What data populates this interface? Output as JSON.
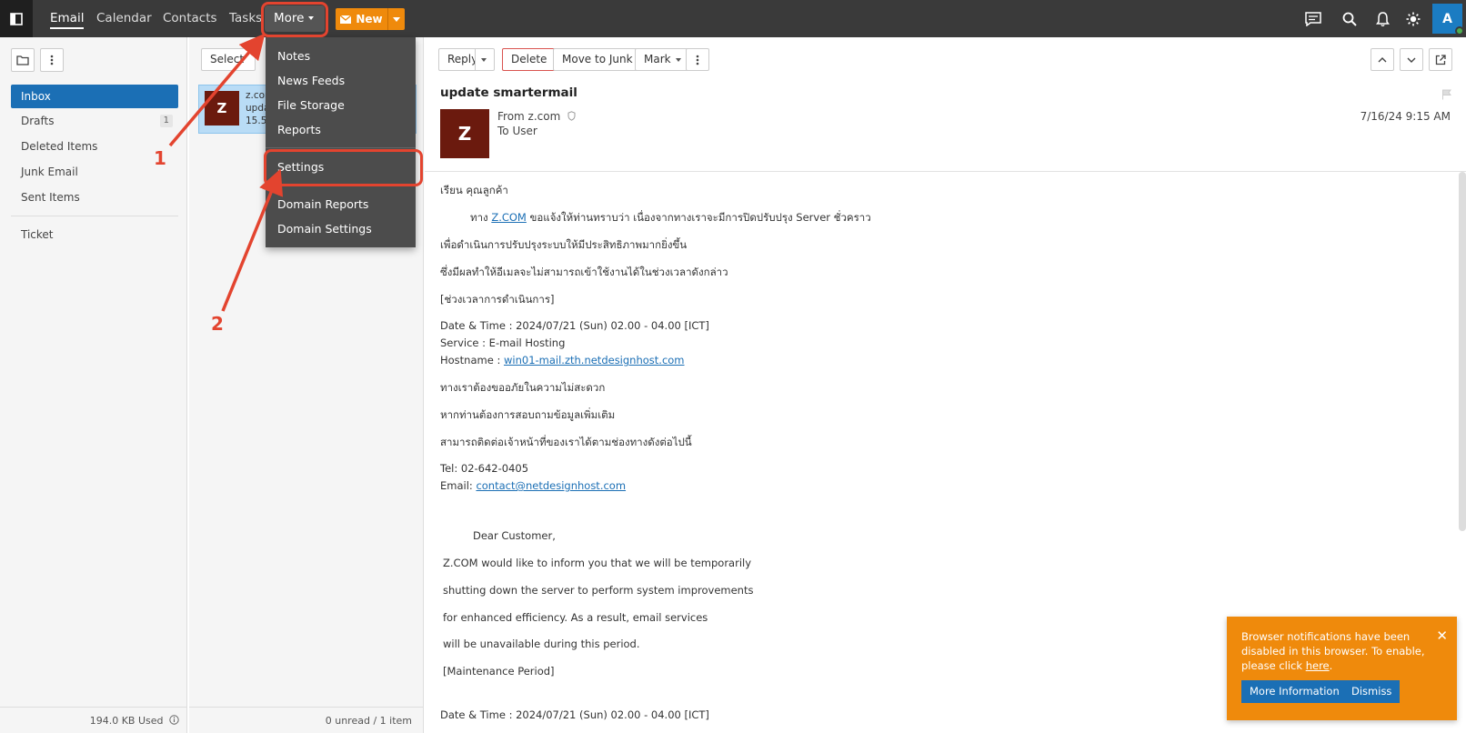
{
  "nav": {
    "tabs": [
      "Email",
      "Calendar",
      "Contacts",
      "Tasks"
    ],
    "more_label": "More",
    "new_label": "New"
  },
  "sidebar": {
    "folders": [
      {
        "label": "Inbox"
      },
      {
        "label": "Drafts",
        "count": "1"
      },
      {
        "label": "Deleted Items"
      },
      {
        "label": "Junk Email"
      },
      {
        "label": "Sent Items"
      }
    ],
    "ticket": "Ticket",
    "storage_used": "194.0 KB Used"
  },
  "list": {
    "select_label": "Select",
    "item": {
      "avatar": "Z",
      "from": "z.com",
      "subject": "upda",
      "size": "15.5 K"
    },
    "footer": "0 unread / 1 item"
  },
  "menu": {
    "items_top": [
      "Notes",
      "News Feeds",
      "File Storage",
      "Reports"
    ],
    "settings": "Settings",
    "items_bottom": [
      "Domain Reports",
      "Domain Settings"
    ]
  },
  "toolbar": {
    "reply": "Reply",
    "delete": "Delete",
    "move_to_junk": "Move to Junk",
    "mark": "Mark"
  },
  "message": {
    "subject": "update smartermail",
    "avatar": "Z",
    "from": "From z.com",
    "to": "To User",
    "date": "7/16/24 9:15 AM",
    "greeting_th": "เรียน คุณลูกค้า",
    "line1_pre": "ทาง ",
    "line1_link": "Z.COM",
    "line1_post": " ขอแจ้งให้ท่านทราบว่า เนื่องจากทางเราจะมีการปิดปรับปรุง Server ชั่วคราว",
    "line2": "เพื่อดำเนินการปรับปรุงระบบให้มีประสิทธิภาพมากยิ่งขึ้น",
    "line3": "ซึ่งมีผลทำให้อีเมลจะไม่สามารถเข้าใช้งานได้ในช่วงเวลาดังกล่าว",
    "period_th": "[ช่วงเวลาการดำเนินการ]",
    "datetime": "Date & Time : 2024/07/21 (Sun) 02.00 - 04.00 [ICT]",
    "service": "Service : E-mail Hosting",
    "hostname_label": "Hostname : ",
    "hostname_link": "win01-mail.zth.netdesignhost.com",
    "apology": "ทางเราต้องขออภัยในความไม่สะดวก",
    "more_info": "หากท่านต้องการสอบถามข้อมูลเพิ่มเติม",
    "contact": "สามารถติดต่อเจ้าหน้าที่ของเราได้ตามช่องทางดังต่อไปนี้",
    "tel": "Tel: 02-642-0405",
    "email_label": "Email: ",
    "email_link": "contact@netdesignhost.com",
    "dear": "Dear Customer,",
    "en1": "Z.COM would like to inform you that we will be temporarily",
    "en2": "shutting down the server to perform system improvements",
    "en3": "for enhanced efficiency. As a result, email services",
    "en4": "will be unavailable during this period.",
    "period_en": "[Maintenance Period]",
    "datetime2": "Date & Time : 2024/07/21 (Sun) 02.00 - 04.00 [ICT]"
  },
  "toast": {
    "message": "Browser notifications have been disabled in this browser. To enable, please click ",
    "link": "here",
    "more_info": "More Information",
    "dismiss": "Dismiss"
  },
  "annotations": {
    "step1": "1",
    "step2": "2"
  },
  "user": {
    "avatar": "A"
  },
  "colors": {
    "topbar": "#3a3a3a",
    "accent_blue": "#1b6fb5",
    "new_orange": "#ef8a0c",
    "annotation_red": "#e3442f",
    "avatar_brown": "#6b1a0e"
  }
}
